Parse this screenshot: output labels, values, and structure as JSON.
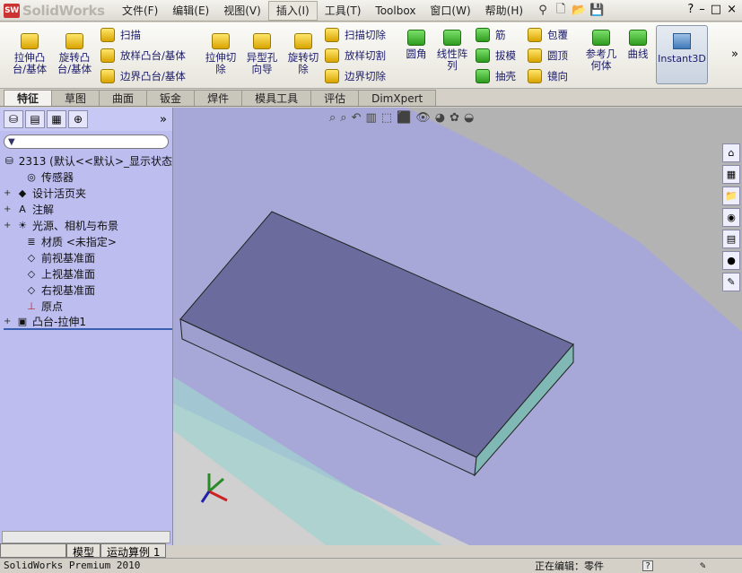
{
  "app": {
    "logo_text": "SolidWorks",
    "logo_badge": "SW"
  },
  "menus": [
    "文件(F)",
    "编辑(E)",
    "视图(V)",
    "插入(I)",
    "工具(T)",
    "Toolbox",
    "窗口(W)",
    "帮助(H)"
  ],
  "active_menu_index": 3,
  "window_controls": [
    "?",
    "–",
    "□",
    "×"
  ],
  "commands": {
    "extrude_boss": "拉伸凸\n台/基体",
    "revolve_boss": "旋转凸\n台/基体",
    "sweep": "扫描",
    "loft_boss": "放样凸台/基体",
    "boundary_boss": "边界凸台/基体",
    "extrude_cut": "拉伸切\n除",
    "hole_wizard": "异型孔\n向导",
    "revolve_cut": "旋转切\n除",
    "sweep_cut": "扫描切除",
    "loft_cut": "放样切割",
    "boundary_cut": "边界切除",
    "fillet": "圆角",
    "linear_pattern": "线性阵\n列",
    "rib": "筋",
    "draft": "拔模",
    "shell": "抽壳",
    "wrap": "包覆",
    "dome": "圆顶",
    "mirror": "镜向",
    "ref_geometry": "参考几\n何体",
    "curves": "曲线",
    "instant3d": "Instant3D"
  },
  "tabs": [
    "特征",
    "草图",
    "曲面",
    "钣金",
    "焊件",
    "模具工具",
    "评估",
    "DimXpert"
  ],
  "active_tab_index": 0,
  "tree": {
    "root": "2313  (默认<<默认>_显示状态",
    "items": [
      {
        "label": "传感器",
        "expand": ""
      },
      {
        "label": "设计活页夹",
        "expand": "+"
      },
      {
        "label": "注解",
        "expand": "+"
      },
      {
        "label": "光源、相机与布景",
        "expand": "+"
      },
      {
        "label": "材质 <未指定>",
        "expand": ""
      },
      {
        "label": "前视基准面",
        "expand": ""
      },
      {
        "label": "上视基准面",
        "expand": ""
      },
      {
        "label": "右视基准面",
        "expand": ""
      },
      {
        "label": "原点",
        "expand": ""
      },
      {
        "label": "凸台-拉伸1",
        "expand": "+"
      }
    ]
  },
  "bottom_tabs": [
    "模型",
    "运动算例 1"
  ],
  "status": {
    "left": "SolidWorks Premium 2010",
    "editing": "正在编辑：零件"
  },
  "colors": {
    "viewport_bg": "#a8a8d8",
    "part_top": "#6b6b9e",
    "part_side": "#7fb8b4"
  }
}
